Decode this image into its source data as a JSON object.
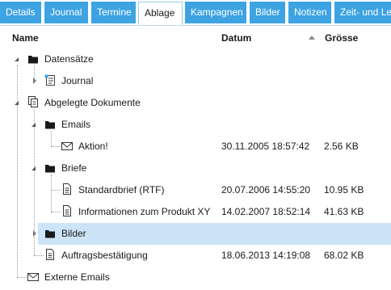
{
  "tabs": [
    {
      "label": "Details",
      "active": false
    },
    {
      "label": "Journal",
      "active": false
    },
    {
      "label": "Termine",
      "active": false
    },
    {
      "label": "Ablage",
      "active": true
    },
    {
      "label": "Kampagnen",
      "active": false
    },
    {
      "label": "Bilder",
      "active": false
    },
    {
      "label": "Notizen",
      "active": false
    },
    {
      "label": "Zeit- und Le",
      "active": false
    }
  ],
  "columns": {
    "name": "Name",
    "date": "Datum",
    "size": "Grösse",
    "sort_column": "size",
    "sort_direction": "ascending"
  },
  "tree": [
    {
      "label": "Datensätze",
      "icon": "folder-icon",
      "expander": "expanded",
      "date": "",
      "size": ""
    },
    {
      "label": "Journal",
      "icon": "journal-icon",
      "expander": "collapsed",
      "date": "",
      "size": ""
    },
    {
      "label": "Abgelegte Dokumente",
      "icon": "documents-icon",
      "expander": "expanded",
      "date": "",
      "size": ""
    },
    {
      "label": "Emails",
      "icon": "folder-icon",
      "expander": "expanded",
      "date": "",
      "size": ""
    },
    {
      "label": "Aktion!",
      "icon": "email-icon",
      "expander": "none",
      "date": "30.11.2005 18:57:42",
      "size": "2.56 KB"
    },
    {
      "label": "Briefe",
      "icon": "folder-icon",
      "expander": "expanded",
      "date": "",
      "size": ""
    },
    {
      "label": "Standardbrief (RTF)",
      "icon": "document-icon",
      "expander": "none",
      "date": "20.07.2006 14:55:20",
      "size": "10.95 KB"
    },
    {
      "label": "Informationen zum Produkt XY",
      "icon": "document-icon",
      "expander": "none",
      "date": "14.02.2007 18:52:14",
      "size": "41.63 KB"
    },
    {
      "label": "Bilder",
      "icon": "folder-icon",
      "expander": "collapsed",
      "date": "",
      "size": "",
      "selected": true
    },
    {
      "label": "Auftragsbestätigung",
      "icon": "document-icon",
      "expander": "none",
      "date": "18.06.2013 14:19:08",
      "size": "68.02 KB"
    },
    {
      "label": "Externe Emails",
      "icon": "email-icon",
      "expander": "none",
      "date": "",
      "size": ""
    }
  ]
}
